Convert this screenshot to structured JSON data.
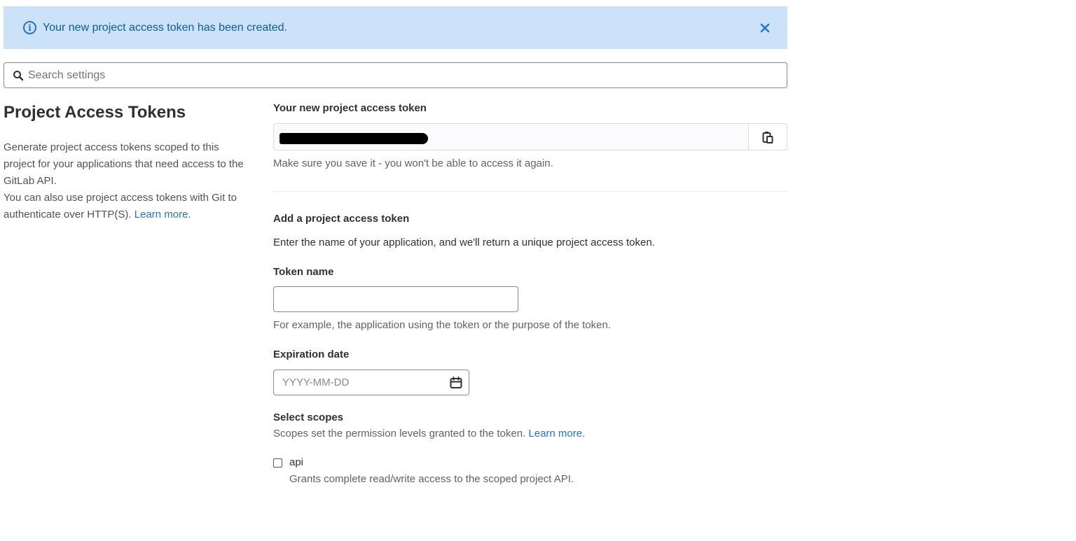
{
  "alert": {
    "message": "Your new project access token has been created."
  },
  "search": {
    "placeholder": "Search settings"
  },
  "left": {
    "title": "Project Access Tokens",
    "paragraph1": "Generate project access tokens scoped to this project for your applications that need access to the GitLab API.",
    "paragraph2": "You can also use project access tokens with Git to authenticate over HTTP(S).",
    "learn_more": "Learn more."
  },
  "new_token": {
    "label": "Your new project access token",
    "help": "Make sure you save it - you won't be able to access it again."
  },
  "add_token": {
    "heading": "Add a project access token",
    "description": "Enter the name of your application, and we'll return a unique project access token.",
    "token_name_label": "Token name",
    "token_name_value": "",
    "token_name_help": "For example, the application using the token or the purpose of the token.",
    "expiration_label": "Expiration date",
    "expiration_placeholder": "YYYY-MM-DD",
    "scopes_label": "Select scopes",
    "scopes_help": "Scopes set the permission levels granted to the token.",
    "scopes_learn_more": "Learn more.",
    "scopes": [
      {
        "name": "api",
        "description": "Grants complete read/write access to the scoped project API.",
        "checked": false
      }
    ]
  },
  "colors": {
    "alert_bg": "#cbe2f9",
    "alert_text": "#0b5cad",
    "link": "#1f75cb"
  }
}
